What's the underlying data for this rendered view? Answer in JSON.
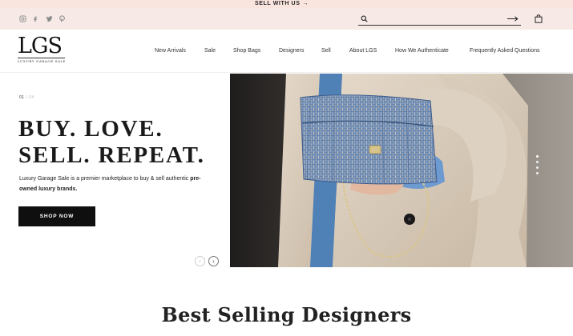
{
  "topbar": {
    "promo_label": "SELL WITH US",
    "promo_arrow": "→"
  },
  "social": [
    {
      "name": "instagram-icon"
    },
    {
      "name": "facebook-icon"
    },
    {
      "name": "twitter-icon"
    },
    {
      "name": "pinterest-icon"
    }
  ],
  "search": {
    "placeholder": "",
    "value": "",
    "submit_icon": "long-arrow-right-icon"
  },
  "cart": {
    "icon": "shopping-bag-icon"
  },
  "logo": {
    "mark": "LGS",
    "subtitle": "LUXURY GARAGE SALE"
  },
  "nav": {
    "items": [
      {
        "label": "New Arrivals"
      },
      {
        "label": "Sale"
      },
      {
        "label": "Shop Bags"
      },
      {
        "label": "Designers"
      },
      {
        "label": "Sell"
      },
      {
        "label": "About LGS"
      },
      {
        "label": "How We Authenticate"
      },
      {
        "label": "Frequently Asked Questions"
      }
    ]
  },
  "hero": {
    "slide_current": "01",
    "slide_total": "/ 04",
    "headline_line1": "BUY. LOVE.",
    "headline_line2": "SELL. REPEAT.",
    "intro_text": "Luxury Garage Sale is a premier marketplace to buy & sell authentic ",
    "intro_bold": "pre-owned luxury brands.",
    "cta_label": "SHOP NOW",
    "prev_arrow": "‹",
    "next_arrow": "›",
    "image_alt": "woman in trench coat holding blue tweed quilted chain bag",
    "dot_count": 4,
    "active_dot": 0
  },
  "section": {
    "title": "Best Selling Designers"
  },
  "colors": {
    "topbar_bg": "#f9e4de",
    "utilbar_bg": "#f7eae6",
    "button_bg": "#0f0f0f"
  }
}
